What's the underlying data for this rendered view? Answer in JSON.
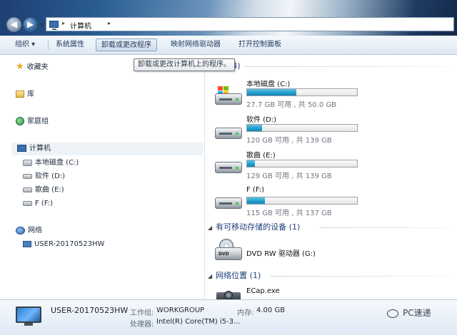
{
  "window": {
    "address_path": "计算机",
    "address_chevron": "▸"
  },
  "toolbar": {
    "organize": "组织 ▾",
    "system_properties": "系统属性",
    "uninstall": "卸载或更改程序",
    "map_drive": "映射网络驱动器",
    "control_panel": "打开控制面板"
  },
  "tooltip": "卸载或更改计算机上的程序。",
  "sidebar": {
    "favorites": "收藏夹",
    "libraries": "库",
    "homegroup": "家庭组",
    "computer": "计算机",
    "drives": [
      "本地磁盘 (C:)",
      "软件 (D:)",
      "歌曲 (E:)",
      "F (F:)"
    ],
    "network": "网络",
    "network_pc": "USER-20170523HW"
  },
  "content": {
    "hdd_group_suffix": "(4)",
    "drives": [
      {
        "name": "本地磁盘 (C:)",
        "free_text": "27.7 GB 可用 , 共 50.0 GB",
        "used_fraction": 0.446
      },
      {
        "name": "软件 (D:)",
        "free_text": "120 GB 可用 , 共 139 GB",
        "used_fraction": 0.137
      },
      {
        "name": "歌曲 (E:)",
        "free_text": "129 GB 可用 , 共 139 GB",
        "used_fraction": 0.072
      },
      {
        "name": "F (F:)",
        "free_text": "115 GB 可用 , 共 137 GB",
        "used_fraction": 0.161
      }
    ],
    "removable_group": "有可移动存储的设备 (1)",
    "dvd_name": "DVD RW 驱动器 (G:)",
    "dvd_label": "DVD",
    "network_group": "网络位置 (1)",
    "network_item": "ECap.exe"
  },
  "details": {
    "computer_name": "USER-20170523HW",
    "workgroup_label": "工作组:",
    "workgroup_value": "WORKGROUP",
    "memory_label": "内存:",
    "memory_value": "4.00 GB",
    "processor_label": "处理器:",
    "processor_value": "Intel(R) Core(TM) i5-3..."
  },
  "watermark": "PC速递"
}
